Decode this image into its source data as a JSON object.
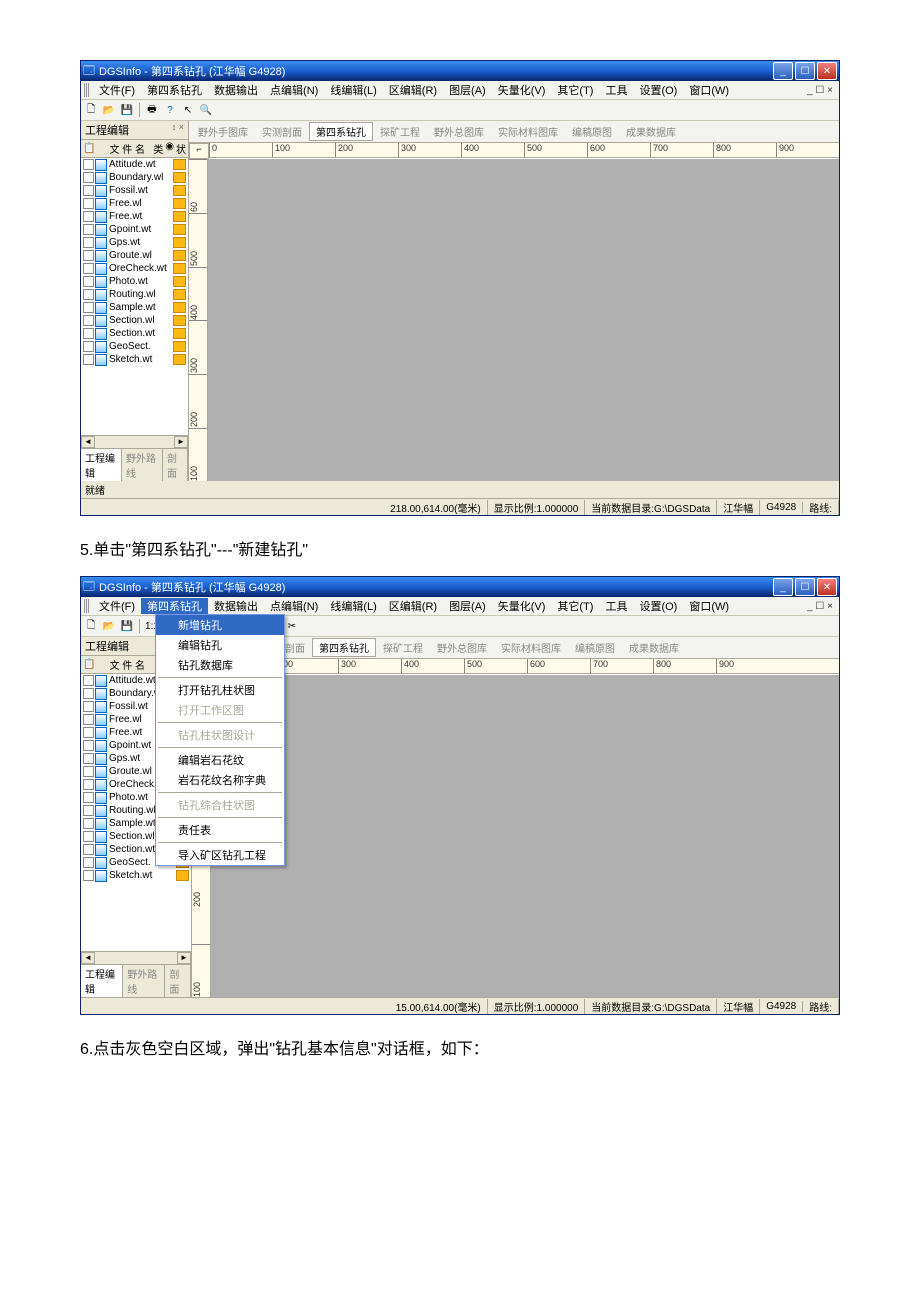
{
  "window1_title": "DGSInfo - 第四系钻孔 (江华幅  G4928)",
  "menubar": {
    "file": "文件(F)",
    "quat": "第四系钻孔",
    "dataout": "数据输出",
    "pointedit": "点编辑(N)",
    "lineedit": "线编辑(L)",
    "areaedit": "区编辑(R)",
    "layer": "图层(A)",
    "vector": "矢量化(V)",
    "other": "其它(T)",
    "tool": "工具",
    "setting": "设置(O)",
    "window": "窗口(W)"
  },
  "side": {
    "title": "工程编辑",
    "pin": "↕ ×",
    "col_name": "文 件 名",
    "tabs": {
      "edit": "工程编辑",
      "route": "野外路线",
      "section": "剖面"
    }
  },
  "files": [
    "Attitude.wt",
    "Boundary.wl",
    "Fossil.wt",
    "Free.wl",
    "Free.wt",
    "Gpoint.wt",
    "Gps.wt",
    "Groute.wl",
    "OreCheck.wt",
    "Photo.wt",
    "Routing.wl",
    "Sample.wt",
    "Section.wl",
    "Section.wt",
    "GeoSect.",
    "Sketch.wt"
  ],
  "canvas_tabs": {
    "t1": "野外手图库",
    "t2": "实测剖面",
    "t3": "第四系钻孔",
    "t4": "探矿工程",
    "t5": "野外总图库",
    "t6": "实际材料图库",
    "t7": "编稿原图",
    "t8": "成果数据库"
  },
  "ruler_h": [
    "0",
    "100",
    "200",
    "300",
    "400",
    "500",
    "600",
    "700",
    "800",
    "900"
  ],
  "ruler_v": [
    "500",
    "400",
    "300",
    "200",
    "100"
  ],
  "ruler_v_top": [
    "60"
  ],
  "status1": {
    "ready": "就绪",
    "coord": "218.00,614.00(毫米)",
    "ratio": "显示比例:1.000000",
    "datadir": "当前数据目录:G:\\DGSData",
    "sheet": "江华幅",
    "code": "G4928",
    "route": "路线:"
  },
  "instruction1": "5.单击\"第四系钻孔\"---\"新建钻孔\"",
  "dropdown": {
    "new_drill": "新增钻孔",
    "edit_drill": "编辑钻孔",
    "drill_db": "钻孔数据库",
    "open_column": "打开钻孔柱状图",
    "open_work": "打开工作区图",
    "column_design": "钻孔柱状图设计",
    "edit_pattern": "编辑岩石花纹",
    "pattern_dict": "岩石花纹名称字典",
    "combined_column": "钻孔综合柱状图",
    "task_table": "责任表",
    "import_proj": "导入矿区钻孔工程"
  },
  "status2": {
    "coord": "15.00,614.00(毫米)",
    "ratio": "显示比例:1.000000",
    "datadir": "当前数据目录:G:\\DGSData",
    "sheet": "江华幅",
    "code": "G4928",
    "route": "路线:"
  },
  "instruction2": "6.点击灰色空白区域，弹出\"钻孔基本信息\"对话框，如下："
}
